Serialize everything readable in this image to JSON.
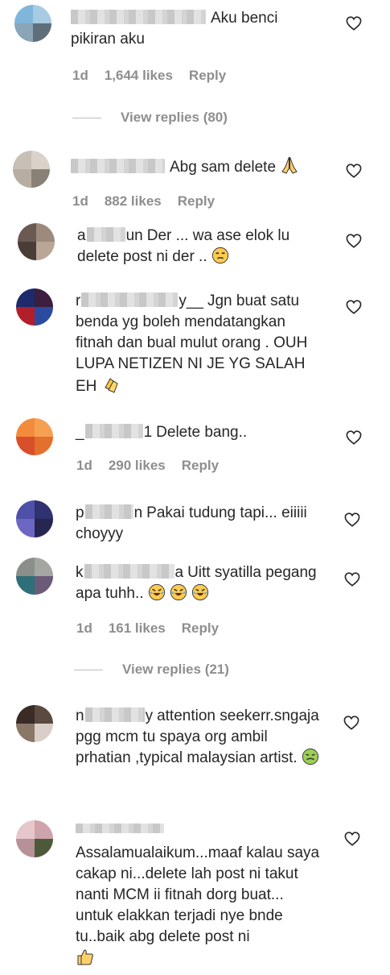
{
  "colors": {
    "text": "#262626",
    "secondary": "#8e8e8e",
    "divider": "#bdbdbd"
  },
  "comments": [
    {
      "username_visible": "_",
      "text": "Aku benci pikiran aku",
      "meta": {
        "time": "1d",
        "likes": "1,644 likes",
        "reply": "Reply"
      },
      "view_replies": "View replies (80)"
    },
    {
      "username_visible": "_",
      "text": "Abg sam delete",
      "emoji": "folded-hands",
      "meta": {
        "time": "1d",
        "likes": "882 likes",
        "reply": "Reply"
      }
    },
    {
      "username_visible": "a",
      "username_tail": "un",
      "text": "Der ... wa ase elok lu delete post ni der ..",
      "emoji": "unamused-face"
    },
    {
      "username_visible": "r",
      "username_tail": "y__",
      "text": "Jgn buat satu benda yg boleh mendatangkan fitnah dan bual mulut orang . OUH LUPA NETIZEN NI JE YG SALAH EH",
      "emoji": "clapping-hands"
    },
    {
      "username_visible": "_",
      "username_tail": "1",
      "text": "Delete bang..",
      "meta": {
        "time": "1d",
        "likes": "290 likes",
        "reply": "Reply"
      }
    },
    {
      "username_visible": "p",
      "username_tail": "n",
      "text": "Pakai tudung tapi... eiiiii choyyy"
    },
    {
      "username_visible": "k",
      "username_tail": "a",
      "text": "Uitt syatilla pegang apa tuhh..",
      "emoji": "rolling-laughing-x3",
      "meta": {
        "time": "1d",
        "likes": "161 likes",
        "reply": "Reply"
      },
      "view_replies": "View replies (21)"
    },
    {
      "username_visible": "n",
      "username_tail": "y",
      "text": "attention seekerr.sngaja pgg mcm tu spaya org ambil prhatian ,typical malaysian artist.",
      "emoji": "nauseated-face"
    },
    {
      "username_visible": "",
      "text": "Assalamualaikum...maaf kalau saya cakap ni...delete lah post ni takut nanti MCM ii fitnah dorg buat... untuk elakkan terjadi nye bnde tu..baik abg delete post ni",
      "emoji": "thumbs-up"
    }
  ],
  "icons": {
    "like": "heart-outline-icon"
  }
}
